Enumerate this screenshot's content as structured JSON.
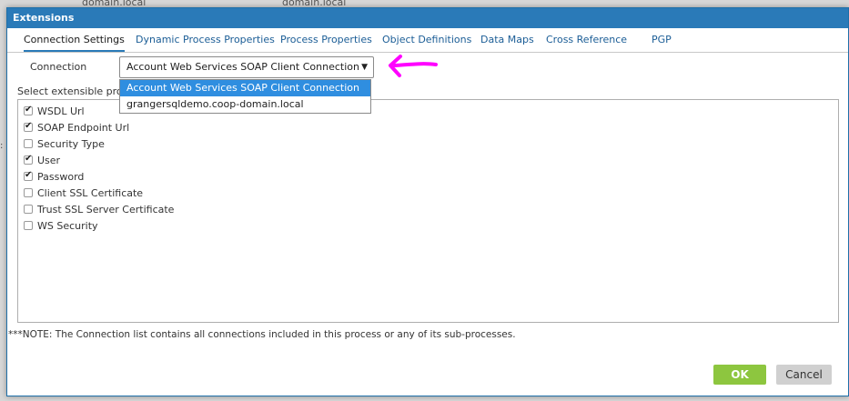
{
  "background": {
    "text_left": "domain.local",
    "text_right": "domain.local"
  },
  "dialog": {
    "title": "Extensions"
  },
  "tabs": [
    {
      "label": "Connection Settings",
      "active": true
    },
    {
      "label": "Dynamic Process Properties"
    },
    {
      "label": "Process Properties"
    },
    {
      "label": "Object Definitions"
    },
    {
      "label": "Data Maps"
    },
    {
      "label": "Cross Reference"
    },
    {
      "label": "PGP"
    }
  ],
  "connection": {
    "label": "Connection",
    "selected": "Account Web Services SOAP Client Connection",
    "options": [
      "Account Web Services SOAP Client Connection",
      "grangersqldemo.coop-domain.local"
    ]
  },
  "extensible": {
    "label": "Select extensible prop",
    "properties": [
      {
        "label": "WSDL Url",
        "checked": true
      },
      {
        "label": "SOAP Endpoint Url",
        "checked": true
      },
      {
        "label": "Security Type",
        "checked": false
      },
      {
        "label": "User",
        "checked": true
      },
      {
        "label": "Password",
        "checked": true
      },
      {
        "label": "Client SSL Certificate",
        "checked": false
      },
      {
        "label": "Trust SSL Server Certificate",
        "checked": false
      },
      {
        "label": "WS Security",
        "checked": false
      }
    ]
  },
  "note": "***NOTE: The Connection list contains all connections included in this process or any of its sub-processes.",
  "buttons": {
    "ok": "OK",
    "cancel": "Cancel"
  },
  "colors": {
    "titlebar": "#2a7ab8",
    "ok": "#8dc63f",
    "annotation_arrow": "#ff00ff",
    "selected_option": "#2f8ee0"
  },
  "icons": {
    "annotation": "arrow-left-icon",
    "dropdown": "triangle-down-icon"
  }
}
